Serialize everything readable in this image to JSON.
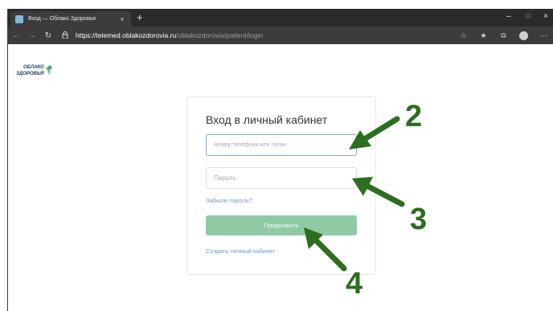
{
  "browser": {
    "tab_title": "Вход — Облако Здоровья",
    "tab_close": "×",
    "new_tab": "+",
    "url_host": "https://telemed.oblakozdorovia.ru",
    "url_path": "/oblakozdorovia/patient/login",
    "window_controls": [
      "–",
      "□",
      "×"
    ]
  },
  "logo": {
    "line1": "ОБЛАКО",
    "line2": "ЗДОРОВЬЯ"
  },
  "login": {
    "title": "Вход в личный кабинет",
    "login_placeholder": "Номер телефона или логин",
    "password_placeholder": "Пароль",
    "forgot_link": "Забыли пароль?",
    "submit_label": "Продолжить",
    "create_link": "Создать личный кабинет"
  },
  "annotations": {
    "step_2": "2",
    "step_3": "3",
    "step_4": "4"
  },
  "colors": {
    "arrow": "#2d6e1f",
    "button": "#8fcaa4",
    "link": "#6c9bcf",
    "chrome_dark": "#2b2b2b"
  }
}
